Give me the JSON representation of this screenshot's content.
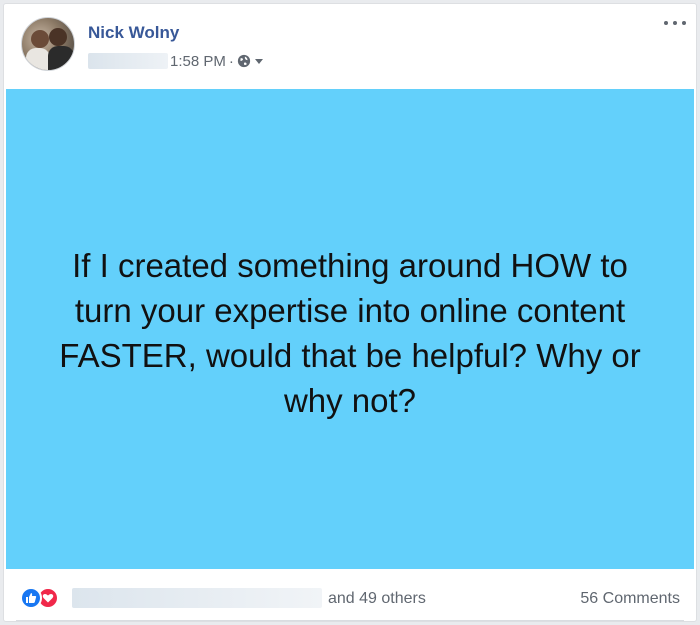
{
  "post": {
    "author": "Nick Wolny",
    "timestamp": "1:58 PM",
    "separator": "·",
    "privacy_icon": "globe-icon",
    "menu_icon": "more-horizontal-icon",
    "card_text": "If I created something around HOW to turn your expertise into online content FASTER, would that be helpful? Why or why not?",
    "card_bg_color": "#63d0fb"
  },
  "footer": {
    "reactions": [
      "like-reaction-icon",
      "love-reaction-icon"
    ],
    "others_text": "and 49 others",
    "comments_text": "56 Comments"
  }
}
